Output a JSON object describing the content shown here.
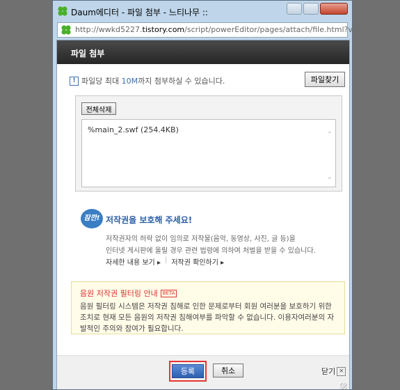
{
  "window": {
    "title": "Daum에디터 - 파일 첨부 - 느티나무 ::",
    "url_prefix": "http://wwkd5227.",
    "url_domain": "tistory.com",
    "url_rest": "/script/powerEditor/pages/attach/file.html?ve"
  },
  "header": {
    "title": "파일 첨부"
  },
  "info": {
    "icon_glyph": "!",
    "text_before": "파일당 최대 ",
    "size": "10M",
    "text_after": "까지 첨부하실 수 있습니다."
  },
  "buttons": {
    "find_file": "파일찾기",
    "delete_all": "전체삭제",
    "submit": "등록",
    "cancel": "취소",
    "close": "닫기"
  },
  "files": [
    {
      "name": "%main_2.swf (254.4KB)"
    }
  ],
  "copyright": {
    "badge": "잠깐!",
    "title": "저작권을 보호해 주세요!",
    "desc1": "저작권자의 허락 없이 임의로 저작물(음악, 동영상, 사진, 글 등)을",
    "desc2": "인터넷 게시판에 올릴 경우 관련 법령에 의하여 처벌을 받을 수 있습니다.",
    "link1": "자세한 내용 보기",
    "link2": "저작권 확인하기"
  },
  "notice": {
    "title": "음원 저작권 필터링 안내",
    "badge": "BETA",
    "body": "음원 필터링 시스템은 저작권 침해로 인한 문제로부터 회원 여러분을 보호하기 위한 조치로 현재 모든 음원의 저작권 침해여부를 파악할 수 없습니다. 이용자여러분의 자발적인 주의와 참여가 필요합니다."
  },
  "colors": {
    "accent_blue": "#3a6fb5",
    "notice_red": "#dd3333",
    "highlight_border": "#e83434"
  }
}
